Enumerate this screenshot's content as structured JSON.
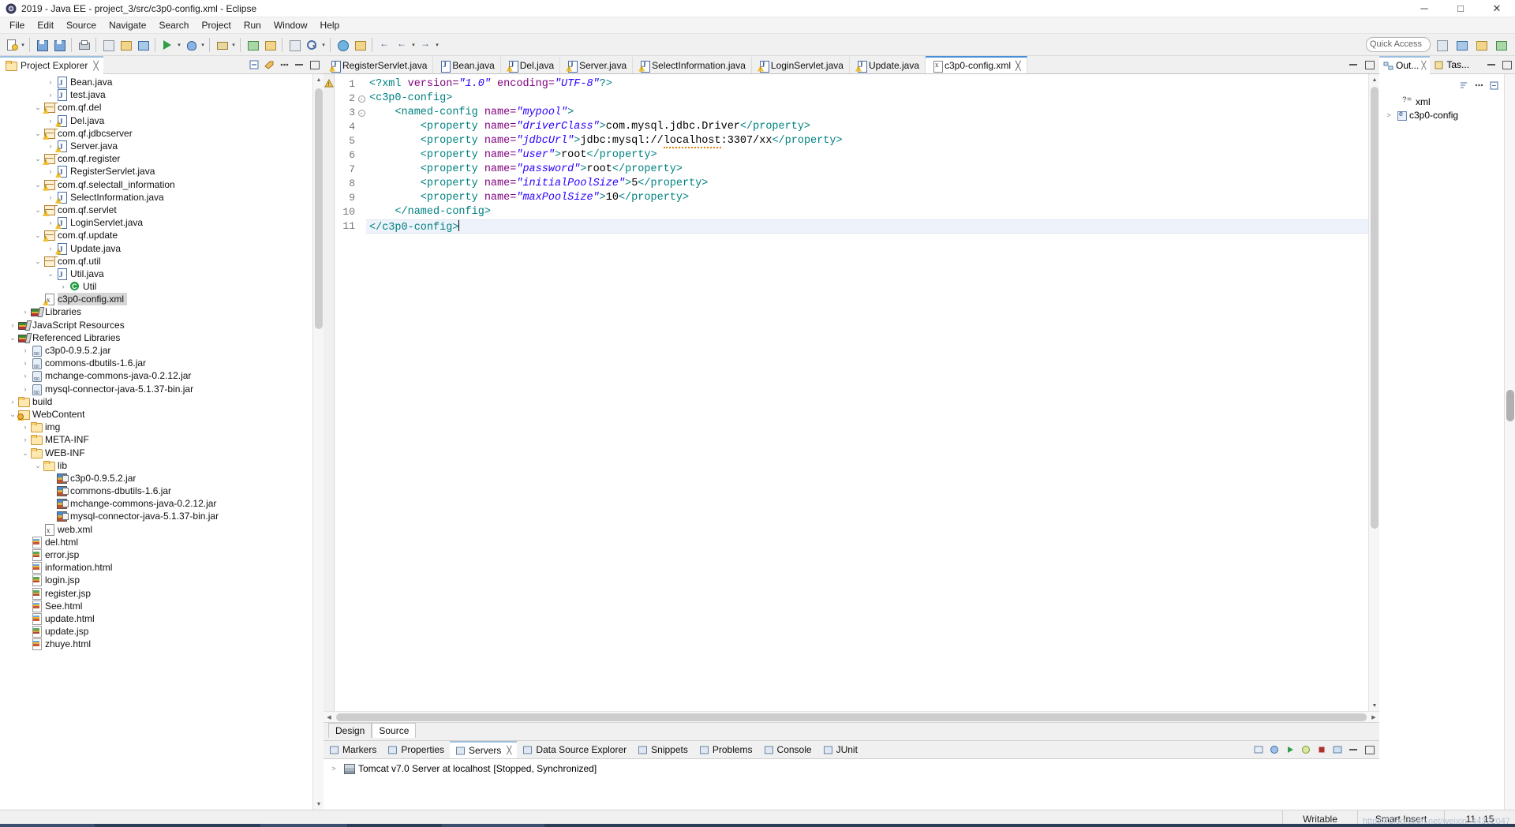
{
  "window": {
    "title": "2019 - Java EE - project_3/src/c3p0-config.xml - Eclipse",
    "app_icon": "eclipse-icon",
    "minimize": "─",
    "maximize": "□",
    "close": "✕"
  },
  "menubar": {
    "items": [
      "File",
      "Edit",
      "Source",
      "Navigate",
      "Search",
      "Project",
      "Run",
      "Window",
      "Help"
    ]
  },
  "toolbar": {
    "quick_access_placeholder": "Quick Access",
    "buttons": [
      "new-wizard-icon",
      "save-icon",
      "print-icon",
      "new-java-project-icon",
      "new-java-class-icon",
      "run-icon",
      "debug-icon",
      "external-tools-icon",
      "new-server-icon",
      "open-type-icon",
      "search-icon",
      "next-annotation-icon",
      "previous-annotation-icon",
      "last-edit-location-icon",
      "back-icon",
      "forward-icon"
    ]
  },
  "project_explorer": {
    "title": "Project Explorer",
    "close_glyph": "╳",
    "tools": [
      "collapse-all-icon",
      "link-with-editor-icon",
      "view-menu-icon",
      "minimize-icon",
      "maximize-icon"
    ],
    "tree": [
      {
        "label": "Bean.java",
        "indent": 4,
        "twisty": ">",
        "icon": "java-file-icon",
        "warn": false
      },
      {
        "label": "test.java",
        "indent": 4,
        "twisty": ">",
        "icon": "java-file-icon",
        "warn": false
      },
      {
        "label": "com.qf.del",
        "indent": 3,
        "twisty": "v",
        "icon": "package-icon",
        "warn": true
      },
      {
        "label": "Del.java",
        "indent": 4,
        "twisty": ">",
        "icon": "java-file-icon",
        "warn": true
      },
      {
        "label": "com.qf.jdbcserver",
        "indent": 3,
        "twisty": "v",
        "icon": "package-icon",
        "warn": true
      },
      {
        "label": "Server.java",
        "indent": 4,
        "twisty": ">",
        "icon": "java-file-icon",
        "warn": true
      },
      {
        "label": "com.qf.register",
        "indent": 3,
        "twisty": "v",
        "icon": "package-icon",
        "warn": true
      },
      {
        "label": "RegisterServlet.java",
        "indent": 4,
        "twisty": ">",
        "icon": "java-file-icon",
        "warn": true
      },
      {
        "label": "com.qf.selectall_information",
        "indent": 3,
        "twisty": "v",
        "icon": "package-icon",
        "warn": true
      },
      {
        "label": "SelectInformation.java",
        "indent": 4,
        "twisty": ">",
        "icon": "java-file-icon",
        "warn": true
      },
      {
        "label": "com.qf.servlet",
        "indent": 3,
        "twisty": "v",
        "icon": "package-icon",
        "warn": true
      },
      {
        "label": "LoginServlet.java",
        "indent": 4,
        "twisty": ">",
        "icon": "java-file-icon",
        "warn": true
      },
      {
        "label": "com.qf.update",
        "indent": 3,
        "twisty": "v",
        "icon": "package-icon",
        "warn": true
      },
      {
        "label": "Update.java",
        "indent": 4,
        "twisty": ">",
        "icon": "java-file-icon",
        "warn": true
      },
      {
        "label": "com.qf.util",
        "indent": 3,
        "twisty": "v",
        "icon": "package-icon",
        "warn": false
      },
      {
        "label": "Util.java",
        "indent": 4,
        "twisty": "v",
        "icon": "java-file-icon",
        "warn": false
      },
      {
        "label": "Util",
        "indent": 5,
        "twisty": ">",
        "icon": "class-icon",
        "warn": false
      },
      {
        "label": "c3p0-config.xml",
        "indent": 3,
        "twisty": "",
        "icon": "xml-file-icon",
        "warn": true,
        "selected": true
      },
      {
        "label": "Libraries",
        "indent": 2,
        "twisty": ">",
        "icon": "library-icon",
        "warn": false
      },
      {
        "label": "JavaScript Resources",
        "indent": 1,
        "twisty": ">",
        "icon": "library-icon",
        "warn": false
      },
      {
        "label": "Referenced Libraries",
        "indent": 1,
        "twisty": "v",
        "icon": "library-icon",
        "warn": false
      },
      {
        "label": "c3p0-0.9.5.2.jar",
        "indent": 2,
        "twisty": ">",
        "icon": "jar-icon",
        "warn": false
      },
      {
        "label": "commons-dbutils-1.6.jar",
        "indent": 2,
        "twisty": ">",
        "icon": "jar-icon",
        "warn": false
      },
      {
        "label": "mchange-commons-java-0.2.12.jar",
        "indent": 2,
        "twisty": ">",
        "icon": "jar-icon",
        "warn": false
      },
      {
        "label": "mysql-connector-java-5.1.37-bin.jar",
        "indent": 2,
        "twisty": ">",
        "icon": "jar-icon",
        "warn": false
      },
      {
        "label": "build",
        "indent": 1,
        "twisty": ">",
        "icon": "folder-icon",
        "warn": false
      },
      {
        "label": "WebContent",
        "indent": 1,
        "twisty": "v",
        "icon": "web-folder-icon",
        "warn": true
      },
      {
        "label": "img",
        "indent": 2,
        "twisty": ">",
        "icon": "folder-icon",
        "warn": false
      },
      {
        "label": "META-INF",
        "indent": 2,
        "twisty": ">",
        "icon": "folder-icon",
        "warn": false
      },
      {
        "label": "WEB-INF",
        "indent": 2,
        "twisty": "v",
        "icon": "folder-icon",
        "warn": false
      },
      {
        "label": "lib",
        "indent": 3,
        "twisty": "v",
        "icon": "folder-icon",
        "warn": false
      },
      {
        "label": "c3p0-0.9.5.2.jar",
        "indent": 4,
        "twisty": "",
        "icon": "web-jar-icon",
        "warn": false
      },
      {
        "label": "commons-dbutils-1.6.jar",
        "indent": 4,
        "twisty": "",
        "icon": "web-jar-icon",
        "warn": false
      },
      {
        "label": "mchange-commons-java-0.2.12.jar",
        "indent": 4,
        "twisty": "",
        "icon": "web-jar-icon",
        "warn": false
      },
      {
        "label": "mysql-connector-java-5.1.37-bin.jar",
        "indent": 4,
        "twisty": "",
        "icon": "web-jar-icon",
        "warn": false
      },
      {
        "label": "web.xml",
        "indent": 3,
        "twisty": "",
        "icon": "xml-file-icon",
        "warn": false
      },
      {
        "label": "del.html",
        "indent": 2,
        "twisty": "",
        "icon": "html-file-icon",
        "warn": false
      },
      {
        "label": "error.jsp",
        "indent": 2,
        "twisty": "",
        "icon": "jsp-file-icon",
        "warn": false
      },
      {
        "label": "information.html",
        "indent": 2,
        "twisty": "",
        "icon": "html-file-icon",
        "warn": false
      },
      {
        "label": "login.jsp",
        "indent": 2,
        "twisty": "",
        "icon": "jsp-file-icon",
        "warn": false
      },
      {
        "label": "register.jsp",
        "indent": 2,
        "twisty": "",
        "icon": "jsp-file-icon",
        "warn": false
      },
      {
        "label": "See.html",
        "indent": 2,
        "twisty": "",
        "icon": "html-file-icon",
        "warn": false
      },
      {
        "label": "update.html",
        "indent": 2,
        "twisty": "",
        "icon": "html-file-icon",
        "warn": false
      },
      {
        "label": "update.jsp",
        "indent": 2,
        "twisty": "",
        "icon": "jsp-file-icon",
        "warn": false
      },
      {
        "label": "zhuye.html",
        "indent": 2,
        "twisty": "",
        "icon": "html-file-icon",
        "warn": false
      }
    ]
  },
  "editor": {
    "tabs": [
      {
        "label": "RegisterServlet.java",
        "active": false,
        "warn": true
      },
      {
        "label": "Bean.java",
        "active": false,
        "warn": false
      },
      {
        "label": "Del.java",
        "active": false,
        "warn": true
      },
      {
        "label": "Server.java",
        "active": false,
        "warn": true
      },
      {
        "label": "SelectInformation.java",
        "active": false,
        "warn": true
      },
      {
        "label": "LoginServlet.java",
        "active": false,
        "warn": true
      },
      {
        "label": "Update.java",
        "active": false,
        "warn": true
      },
      {
        "label": "c3p0-config.xml",
        "active": true,
        "warn": false
      }
    ],
    "close_glyph": "╳",
    "line_numbers": [
      "1",
      "2",
      "3",
      "4",
      "5",
      "6",
      "7",
      "8",
      "9",
      "10",
      "11"
    ],
    "lines": [
      {
        "n": 1,
        "fold": "",
        "segments": [
          {
            "t": "<?xml ",
            "c": "tag"
          },
          {
            "t": "version=",
            "c": "attr"
          },
          {
            "t": "\"1.0\"",
            "c": "val"
          },
          {
            "t": " encoding=",
            "c": "attr"
          },
          {
            "t": "\"UTF-8\"",
            "c": "val"
          },
          {
            "t": "?>",
            "c": "tag"
          }
        ]
      },
      {
        "n": 2,
        "fold": "-",
        "segments": [
          {
            "t": "<c3p0-config>",
            "c": "tag"
          }
        ]
      },
      {
        "n": 3,
        "fold": "-",
        "segments": [
          {
            "t": "    <named-config ",
            "c": "tag"
          },
          {
            "t": "name=",
            "c": "attr"
          },
          {
            "t": "\"mypool\"",
            "c": "val"
          },
          {
            "t": ">",
            "c": "tag"
          }
        ]
      },
      {
        "n": 4,
        "fold": "",
        "segments": [
          {
            "t": "        <property ",
            "c": "tag"
          },
          {
            "t": "name=",
            "c": "attr"
          },
          {
            "t": "\"driverClass\"",
            "c": "val"
          },
          {
            "t": ">",
            "c": "tag"
          },
          {
            "t": "com.mysql.jdbc.Driver",
            "c": "text"
          },
          {
            "t": "</property>",
            "c": "tag"
          }
        ]
      },
      {
        "n": 5,
        "fold": "",
        "segments": [
          {
            "t": "        <property ",
            "c": "tag"
          },
          {
            "t": "name=",
            "c": "attr"
          },
          {
            "t": "\"jdbcUrl\"",
            "c": "val"
          },
          {
            "t": ">",
            "c": "tag"
          },
          {
            "t": "jdbc:mysql://",
            "c": "text"
          },
          {
            "t": "localhost",
            "c": "spell"
          },
          {
            "t": ":3307/xx",
            "c": "text"
          },
          {
            "t": "</property>",
            "c": "tag"
          }
        ]
      },
      {
        "n": 6,
        "fold": "",
        "segments": [
          {
            "t": "        <property ",
            "c": "tag"
          },
          {
            "t": "name=",
            "c": "attr"
          },
          {
            "t": "\"user\"",
            "c": "val"
          },
          {
            "t": ">",
            "c": "tag"
          },
          {
            "t": "root",
            "c": "text"
          },
          {
            "t": "</property>",
            "c": "tag"
          }
        ]
      },
      {
        "n": 7,
        "fold": "",
        "segments": [
          {
            "t": "        <property ",
            "c": "tag"
          },
          {
            "t": "name=",
            "c": "attr"
          },
          {
            "t": "\"password\"",
            "c": "val"
          },
          {
            "t": ">",
            "c": "tag"
          },
          {
            "t": "root",
            "c": "text"
          },
          {
            "t": "</property>",
            "c": "tag"
          }
        ]
      },
      {
        "n": 8,
        "fold": "",
        "segments": [
          {
            "t": "        <property ",
            "c": "tag"
          },
          {
            "t": "name=",
            "c": "attr"
          },
          {
            "t": "\"initialPoolSize\"",
            "c": "val"
          },
          {
            "t": ">",
            "c": "tag"
          },
          {
            "t": "5",
            "c": "text"
          },
          {
            "t": "</property>",
            "c": "tag"
          }
        ]
      },
      {
        "n": 9,
        "fold": "",
        "segments": [
          {
            "t": "        <property ",
            "c": "tag"
          },
          {
            "t": "name=",
            "c": "attr"
          },
          {
            "t": "\"maxPoolSize\"",
            "c": "val"
          },
          {
            "t": ">",
            "c": "tag"
          },
          {
            "t": "10",
            "c": "text"
          },
          {
            "t": "</property>",
            "c": "tag"
          }
        ]
      },
      {
        "n": 10,
        "fold": "",
        "segments": [
          {
            "t": "    </named-config>",
            "c": "tag"
          }
        ]
      },
      {
        "n": 11,
        "fold": "",
        "current": true,
        "segments": [
          {
            "t": "</c3p0-config>",
            "c": "tag"
          }
        ]
      }
    ],
    "design_source": {
      "design_label": "Design",
      "source_label": "Source",
      "active": "Source"
    }
  },
  "bottom_panel": {
    "tabs": [
      {
        "label": "Markers",
        "icon": "markers-icon",
        "active": false
      },
      {
        "label": "Properties",
        "icon": "properties-icon",
        "active": false
      },
      {
        "label": "Servers",
        "icon": "servers-icon",
        "active": true
      },
      {
        "label": "Data Source Explorer",
        "icon": "data-source-icon",
        "active": false
      },
      {
        "label": "Snippets",
        "icon": "snippets-icon",
        "active": false
      },
      {
        "label": "Problems",
        "icon": "problems-icon",
        "active": false
      },
      {
        "label": "Console",
        "icon": "console-icon",
        "active": false
      },
      {
        "label": "JUnit",
        "icon": "junit-icon",
        "active": false
      }
    ],
    "close_glyph": "╳",
    "server": {
      "twisty": ">",
      "name": "Tomcat v7.0 Server at localhost",
      "state": "[Stopped, Synchronized]"
    }
  },
  "outline": {
    "tabs": [
      {
        "label": "Out...",
        "active": true
      },
      {
        "label": "Tas...",
        "active": false
      }
    ],
    "close_glyph": "╳",
    "rows": [
      {
        "label": "xml",
        "indent": 1,
        "twisty": "",
        "icon": "xml-declaration-icon"
      },
      {
        "label": "c3p0-config",
        "indent": 1,
        "twisty": ">",
        "icon": "xml-element-icon"
      }
    ]
  },
  "statusbar": {
    "writable": "Writable",
    "insert_mode": "Smart Insert",
    "position": "11 : 15",
    "watermark": "https://blog.csdn.net/weixin_44392047"
  }
}
